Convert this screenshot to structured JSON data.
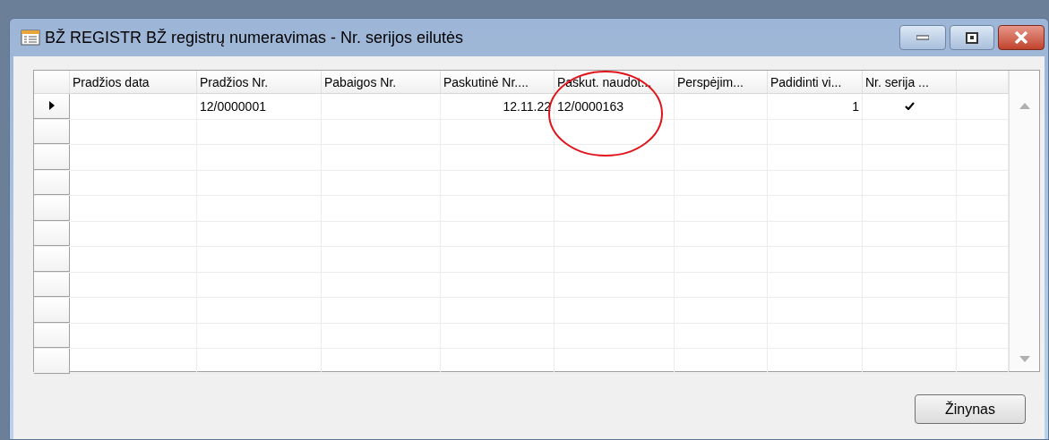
{
  "window": {
    "title": "BŽ REGISTR BŽ registrų numeravimas - Nr. serijos eilutės"
  },
  "table": {
    "columns": [
      "Pradžios data",
      "Pradžios Nr.",
      "Pabaigos Nr.",
      "Paskutinė Nr....",
      "Paskut. naudot...",
      "Perspėjim...",
      "Padidinti vi...",
      "Nr. serija ..."
    ],
    "rows": [
      {
        "current": true,
        "cells": [
          "",
          "12/0000001",
          "",
          "12.11.22",
          "12/0000163",
          "",
          "1"
        ],
        "checked": true
      }
    ]
  },
  "buttons": [
    "Žinynas"
  ]
}
